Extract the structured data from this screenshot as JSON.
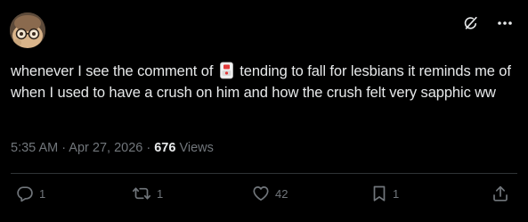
{
  "post": {
    "text_before_emoji": "whenever I see the comment of ",
    "emoji": "gacha-card-emoji",
    "text_after_emoji": " tending to fall for lesbians it reminds me of when I used to have a crush on him and how the crush felt very sapphic ww",
    "time": "5:35 AM",
    "separator_1": " · ",
    "date": "Apr 27, 2026",
    "separator_2": " · ",
    "views_count": "676",
    "views_label": " Views"
  },
  "actions": {
    "replies": "1",
    "reposts": "1",
    "likes": "42",
    "bookmarks": "1"
  },
  "icons": {
    "grok": "grok-icon",
    "more": "more-dots-icon",
    "reply": "reply-icon",
    "repost": "repost-icon",
    "like": "heart-icon",
    "bookmark": "bookmark-icon",
    "share": "share-icon"
  },
  "colors": {
    "background": "#000000",
    "text": "#e7e9ea",
    "muted": "#71767b",
    "divider": "#2f3336"
  }
}
